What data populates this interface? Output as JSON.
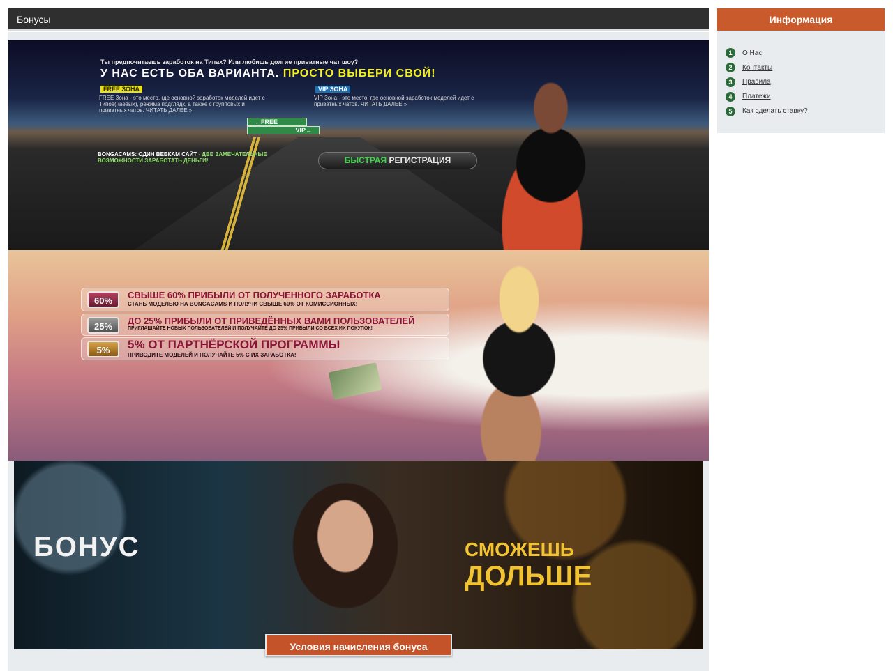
{
  "header": {
    "title": "Бонусы"
  },
  "banner1": {
    "small_line": "Ты предпочитаешь заработок на Типах? Или любишь долгие приватные чат шоу?",
    "headline_main": "У НАС ЕСТЬ ОБА ВАРИАНТА.",
    "headline_highlight": "ПРОСТО ВЫБЕРИ СВОЙ!",
    "free_tag": "FREE ЗОНА",
    "free_text": "FREE Зона - это место, где основной заработок моделей идет с Типов(чаевых), режима подглядк, а также с групповых и приватных чатов. ЧИТАТЬ ДАЛЕЕ »",
    "vip_tag": "VIP ЗОНА",
    "vip_text": "VIP Зона - это место, где основной заработок моделей идет с приватных чатов. ЧИТАТЬ ДАЛЕЕ »",
    "sign_free": "←FREE",
    "sign_vip": "VIP→",
    "bonga_prefix": "BONGACAMS: ОДИН ВЕБКАМ САЙТ",
    "bonga_rest": "- ДВЕ ЗАМЕЧАТЕЛЬНЫЕ ВОЗМОЖНОСТИ ЗАРАБОТАТЬ ДЕНЬГИ!",
    "reg_green": "БЫСТРАЯ",
    "reg_rest": "РЕГИСТРАЦИЯ"
  },
  "banner2": {
    "rows": [
      {
        "pct": "60%",
        "head": "СВЫШЕ 60% ПРИБЫЛИ ОТ ПОЛУЧЕННОГО ЗАРАБОТКА",
        "sub": "СТАНЬ МОДЕЛЬЮ НА BONGACAMS И ПОЛУЧИ СВЫШЕ 60% ОТ КОМИССИОННЫХ!"
      },
      {
        "pct": "25%",
        "head": "ДО 25% ПРИБЫЛИ ОТ ПРИВЕДЁННЫХ ВАМИ ПОЛЬЗОВАТЕЛЕЙ",
        "sub": "ПРИГЛАШАЙТЕ НОВЫХ ПОЛЬЗОВАТЕЛЕЙ И ПОЛУЧАЙТЕ ДО 25% ПРИБЫЛИ СО ВСЕХ ИХ ПОКУПОК!"
      },
      {
        "pct": "5%",
        "head": "5% ОТ ПАРТНЁРСКОЙ ПРОГРАММЫ",
        "sub": "ПРИВОДИТЕ МОДЕЛЕЙ И ПОЛУЧАЙТЕ 5% С ИХ ЗАРАБОТКА!"
      }
    ]
  },
  "banner3": {
    "bonus_word": "БОНУС",
    "slogan_small": "СМОЖЕШЬ",
    "slogan_big": "ДОЛЬШЕ"
  },
  "cta": {
    "label": "Условия начисления бонуса"
  },
  "sidebar": {
    "title": "Информация",
    "items": [
      {
        "num": "1",
        "label": "О Нас"
      },
      {
        "num": "2",
        "label": "Контакты"
      },
      {
        "num": "3",
        "label": "Правила"
      },
      {
        "num": "4",
        "label": "Платежи"
      },
      {
        "num": "5",
        "label": "Как сделать ставку?"
      }
    ]
  },
  "colors": {
    "accent": "#c95a2b",
    "header_bg": "#2f2f2f",
    "panel_bg": "#e9ecef",
    "badge": "#2d6a3a"
  }
}
